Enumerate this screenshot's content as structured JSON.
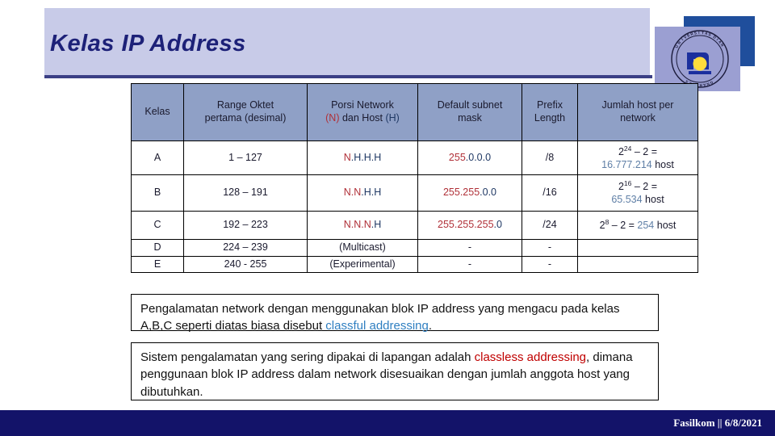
{
  "slide": {
    "title": "Kelas IP Address",
    "logo_alt": "udinus-university-seal"
  },
  "table": {
    "headers": {
      "kelas": "Kelas",
      "range_line1": "Range Oktet",
      "range_line2": "pertama (desimal)",
      "porsi_line1": "Porsi Network",
      "porsi_n": "(N)",
      "porsi_mid": " dan Host ",
      "porsi_h": "(H)",
      "mask_line1": "Default subnet",
      "mask_line2": "mask",
      "prefix_line1": "Prefix",
      "prefix_line2": "Length",
      "jumlah_line1": "Jumlah host per",
      "jumlah_line2": "network"
    },
    "rows": [
      {
        "kelas": "A",
        "range": "1 – 127",
        "porsi_net": "N",
        "porsi_host": ".H.H.H",
        "mask_net": "255",
        "mask_host": ".0.0.0",
        "prefix": "/8",
        "host_base": "2",
        "host_exp": "24",
        "host_minus": " – 2 =",
        "host_count": "16.777.214",
        "host_unit": " host"
      },
      {
        "kelas": "B",
        "range": "128 – 191",
        "porsi_net": "N.N",
        "porsi_host": ".H.H",
        "mask_net": "255.255",
        "mask_host": ".0.0",
        "prefix": "/16",
        "host_base": "2",
        "host_exp": "16",
        "host_minus": " – 2 =",
        "host_count": "65.534",
        "host_unit": " host"
      },
      {
        "kelas": "C",
        "range": "192 – 223",
        "porsi_net": "N.N.N",
        "porsi_host": ".H",
        "mask_net": "255.255.255",
        "mask_host": ".0",
        "prefix": "/24",
        "host_base": "2",
        "host_exp": "8",
        "host_minus": " – 2 = ",
        "host_count": "254",
        "host_unit": " host"
      },
      {
        "kelas": "D",
        "range": "224 – 239",
        "porsi_plain": "(Multicast)",
        "mask_plain": "-",
        "prefix": "-",
        "host_plain": ""
      },
      {
        "kelas": "E",
        "range": "240 - 255",
        "porsi_plain": "(Experimental)",
        "mask_plain": "-",
        "prefix": "-",
        "host_plain": ""
      }
    ]
  },
  "notes": {
    "note1_part1": "Pengalamatan network dengan menggunakan blok IP address yang mengacu pada kelas A,B,C  seperti diatas biasa disebut ",
    "note1_em": "classful addressing",
    "note1_part2": ".",
    "note2_part1": "Sistem pengalamatan yang sering dipakai di lapangan adalah ",
    "note2_em": "classless addressing",
    "note2_part2": ", dimana penggunaan blok IP address dalam network disesuaikan dengan jumlah anggota host yang dibutuhkan."
  },
  "footer": {
    "text": "Fasilkom || 6/8/2021"
  },
  "colors": {
    "banner": "#c8cbe8",
    "title": "#1d2178",
    "header_cell": "#8fa0c6",
    "network_red": "#b03038",
    "host_navy": "#1f3864",
    "count_blue": "#5f7fa6",
    "classful_blue": "#2f7fc1",
    "classless_red": "#c00000",
    "footer_navy": "#131369"
  }
}
